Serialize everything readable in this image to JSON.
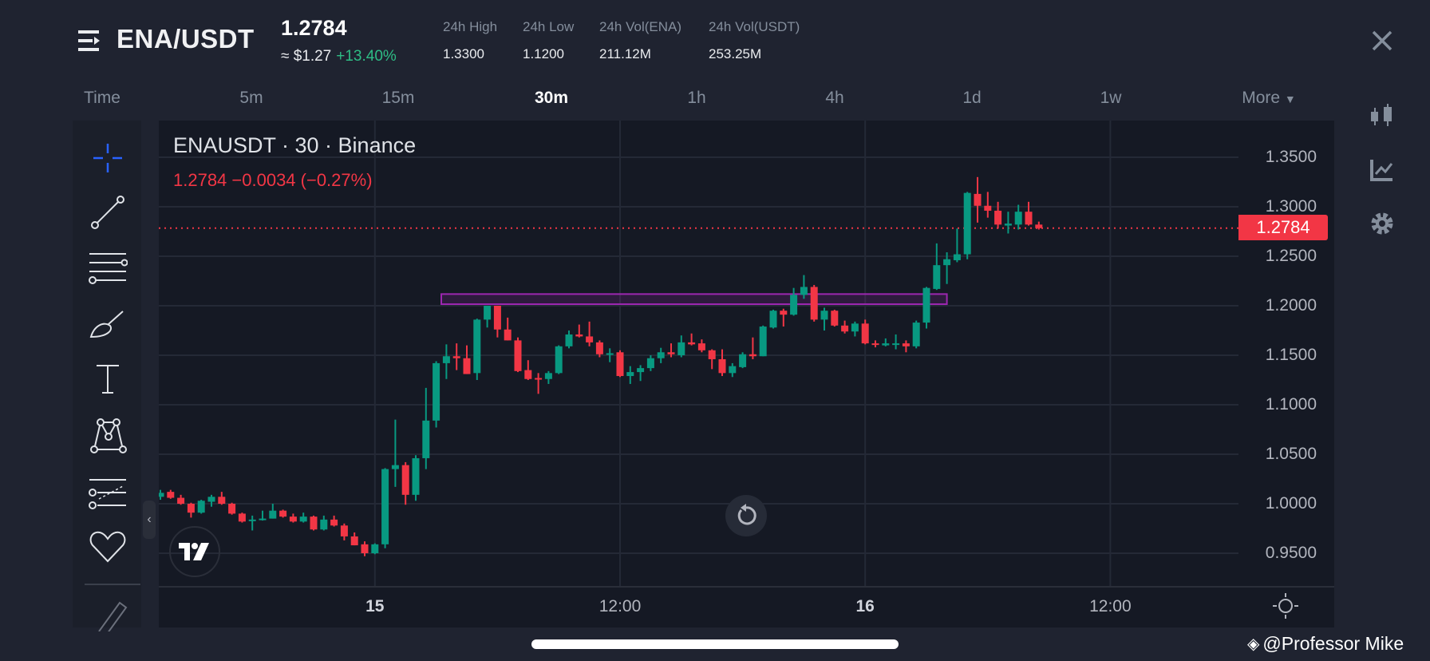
{
  "header": {
    "pair": "ENA/USDT",
    "last_price": "1.2784",
    "usd_price": "≈ $1.27",
    "change_pct": "+13.40%",
    "stats": [
      {
        "label": "24h High",
        "value": "1.3300"
      },
      {
        "label": "24h Low",
        "value": "1.1200"
      },
      {
        "label": "24h Vol(ENA)",
        "value": "211.12M"
      },
      {
        "label": "24h Vol(USDT)",
        "value": "253.25M"
      }
    ]
  },
  "timeframes": {
    "items": [
      "Time",
      "5m",
      "15m",
      "30m",
      "1h",
      "4h",
      "1d",
      "1w"
    ],
    "active": "30m",
    "more_label": "More"
  },
  "chart_legend": {
    "symbol_line": "ENAUSDT · 30 · Binance",
    "price_line": "1.2784  −0.0034 (−0.27%)"
  },
  "watermark": "@Professor Mike",
  "colors": {
    "up": "#089981",
    "down": "#f23645",
    "zone": "#9c27b0",
    "accent_blue": "#2962ff"
  },
  "chart_data": {
    "type": "candlestick",
    "title": "ENAUSDT · 30 · Binance",
    "interval": "30m",
    "current_price": 1.2784,
    "current_price_label": "1.2784",
    "ylim": [
      0.915,
      1.378
    ],
    "y_ticks": [
      "1.3500",
      "1.3000",
      "1.2500",
      "1.2000",
      "1.1500",
      "1.1000",
      "1.0500",
      "1.0000",
      "0.9500"
    ],
    "y_tick_values": [
      1.35,
      1.3,
      1.25,
      1.2,
      1.15,
      1.1,
      1.05,
      1.0,
      0.95
    ],
    "x_ticks": [
      {
        "label": "15",
        "index": 21,
        "bold": true
      },
      {
        "label": "12:00",
        "index": 45
      },
      {
        "label": "16",
        "index": 69,
        "bold": true
      },
      {
        "label": "12:00",
        "index": 93
      }
    ],
    "zone": {
      "from_index": 27.5,
      "to_index": 77,
      "low": 1.2016,
      "high": 1.2118
    },
    "candles_ohlc": [
      [
        1.007,
        1.014,
        1.004,
        1.011
      ],
      [
        1.012,
        1.014,
        1.005,
        1.006
      ],
      [
        1.006,
        1.009,
        0.999,
        1.0
      ],
      [
        1.0,
        1.001,
        0.986,
        0.991
      ],
      [
        0.991,
        1.004,
        0.99,
        1.003
      ],
      [
        1.002,
        1.009,
        0.997,
        1.007
      ],
      [
        1.007,
        1.012,
        0.999,
        1.0
      ],
      [
        1.0,
        1.001,
        0.989,
        0.99
      ],
      [
        0.99,
        0.991,
        0.981,
        0.982
      ],
      [
        0.983,
        0.988,
        0.973,
        0.984
      ],
      [
        0.984,
        0.993,
        0.983,
        0.985
      ],
      [
        0.985,
        1.0,
        0.985,
        0.993
      ],
      [
        0.993,
        0.994,
        0.986,
        0.987
      ],
      [
        0.987,
        0.99,
        0.981,
        0.982
      ],
      [
        0.982,
        0.991,
        0.981,
        0.987
      ],
      [
        0.987,
        0.988,
        0.973,
        0.974
      ],
      [
        0.974,
        0.988,
        0.973,
        0.984
      ],
      [
        0.984,
        0.988,
        0.977,
        0.978
      ],
      [
        0.978,
        0.98,
        0.963,
        0.967
      ],
      [
        0.967,
        0.971,
        0.958,
        0.958
      ],
      [
        0.959,
        0.962,
        0.947,
        0.95
      ],
      [
        0.95,
        0.96,
        0.949,
        0.959
      ],
      [
        0.959,
        1.036,
        0.955,
        1.035
      ],
      [
        1.035,
        1.085,
        1.017,
        1.039
      ],
      [
        1.039,
        1.042,
        0.999,
        1.009
      ],
      [
        1.009,
        1.049,
        1.003,
        1.046
      ],
      [
        1.046,
        1.117,
        1.035,
        1.084
      ],
      [
        1.084,
        1.144,
        1.077,
        1.142
      ],
      [
        1.142,
        1.161,
        1.126,
        1.149
      ],
      [
        1.149,
        1.162,
        1.135,
        1.147
      ],
      [
        1.147,
        1.16,
        1.131,
        1.131
      ],
      [
        1.132,
        1.187,
        1.125,
        1.186
      ],
      [
        1.186,
        1.2,
        1.178,
        1.2
      ],
      [
        1.2,
        1.2,
        1.168,
        1.176
      ],
      [
        1.176,
        1.188,
        1.165,
        1.165
      ],
      [
        1.165,
        1.168,
        1.133,
        1.134
      ],
      [
        1.135,
        1.145,
        1.125,
        1.126
      ],
      [
        1.127,
        1.132,
        1.111,
        1.126
      ],
      [
        1.126,
        1.134,
        1.121,
        1.132
      ],
      [
        1.132,
        1.16,
        1.131,
        1.159
      ],
      [
        1.159,
        1.175,
        1.157,
        1.171
      ],
      [
        1.171,
        1.181,
        1.168,
        1.169
      ],
      [
        1.169,
        1.184,
        1.159,
        1.163
      ],
      [
        1.163,
        1.165,
        1.148,
        1.151
      ],
      [
        1.151,
        1.157,
        1.143,
        1.152
      ],
      [
        1.153,
        1.155,
        1.128,
        1.129
      ],
      [
        1.129,
        1.139,
        1.121,
        1.133
      ],
      [
        1.133,
        1.14,
        1.124,
        1.137
      ],
      [
        1.137,
        1.15,
        1.134,
        1.147
      ],
      [
        1.147,
        1.1575,
        1.142,
        1.153
      ],
      [
        1.153,
        1.162,
        1.148,
        1.151
      ],
      [
        1.15,
        1.17,
        1.148,
        1.163
      ],
      [
        1.163,
        1.172,
        1.16,
        1.161
      ],
      [
        1.162,
        1.166,
        1.153,
        1.155
      ],
      [
        1.155,
        1.156,
        1.136,
        1.146
      ],
      [
        1.146,
        1.156,
        1.129,
        1.132
      ],
      [
        1.132,
        1.142,
        1.128,
        1.139
      ],
      [
        1.138,
        1.153,
        1.137,
        1.151
      ],
      [
        1.151,
        1.168,
        1.146,
        1.149
      ],
      [
        1.149,
        1.18,
        1.149,
        1.179
      ],
      [
        1.178,
        1.196,
        1.177,
        1.195
      ],
      [
        1.195,
        1.197,
        1.179,
        1.191
      ],
      [
        1.191,
        1.218,
        1.19,
        1.211
      ],
      [
        1.211,
        1.231,
        1.207,
        1.219
      ],
      [
        1.219,
        1.221,
        1.184,
        1.186
      ],
      [
        1.186,
        1.198,
        1.175,
        1.195
      ],
      [
        1.195,
        1.196,
        1.179,
        1.18
      ],
      [
        1.18,
        1.185,
        1.172,
        1.174
      ],
      [
        1.174,
        1.184,
        1.169,
        1.182
      ],
      [
        1.182,
        1.186,
        1.161,
        1.162
      ],
      [
        1.162,
        1.165,
        1.158,
        1.161
      ],
      [
        1.16,
        1.167,
        1.159,
        1.162
      ],
      [
        1.161,
        1.171,
        1.156,
        1.162
      ],
      [
        1.162,
        1.165,
        1.153,
        1.159
      ],
      [
        1.159,
        1.185,
        1.157,
        1.183
      ],
      [
        1.183,
        1.219,
        1.177,
        1.218
      ],
      [
        1.217,
        1.263,
        1.216,
        1.241
      ],
      [
        1.241,
        1.254,
        1.222,
        1.247
      ],
      [
        1.246,
        1.278,
        1.244,
        1.252
      ],
      [
        1.252,
        1.315,
        1.247,
        1.314
      ],
      [
        1.313,
        1.33,
        1.284,
        1.301
      ],
      [
        1.301,
        1.315,
        1.289,
        1.296
      ],
      [
        1.296,
        1.305,
        1.278,
        1.282
      ],
      [
        1.281,
        1.295,
        1.273,
        1.283
      ],
      [
        1.282,
        1.302,
        1.277,
        1.295
      ],
      [
        1.295,
        1.305,
        1.281,
        1.282
      ],
      [
        1.282,
        1.285,
        1.277,
        1.2784
      ]
    ]
  }
}
